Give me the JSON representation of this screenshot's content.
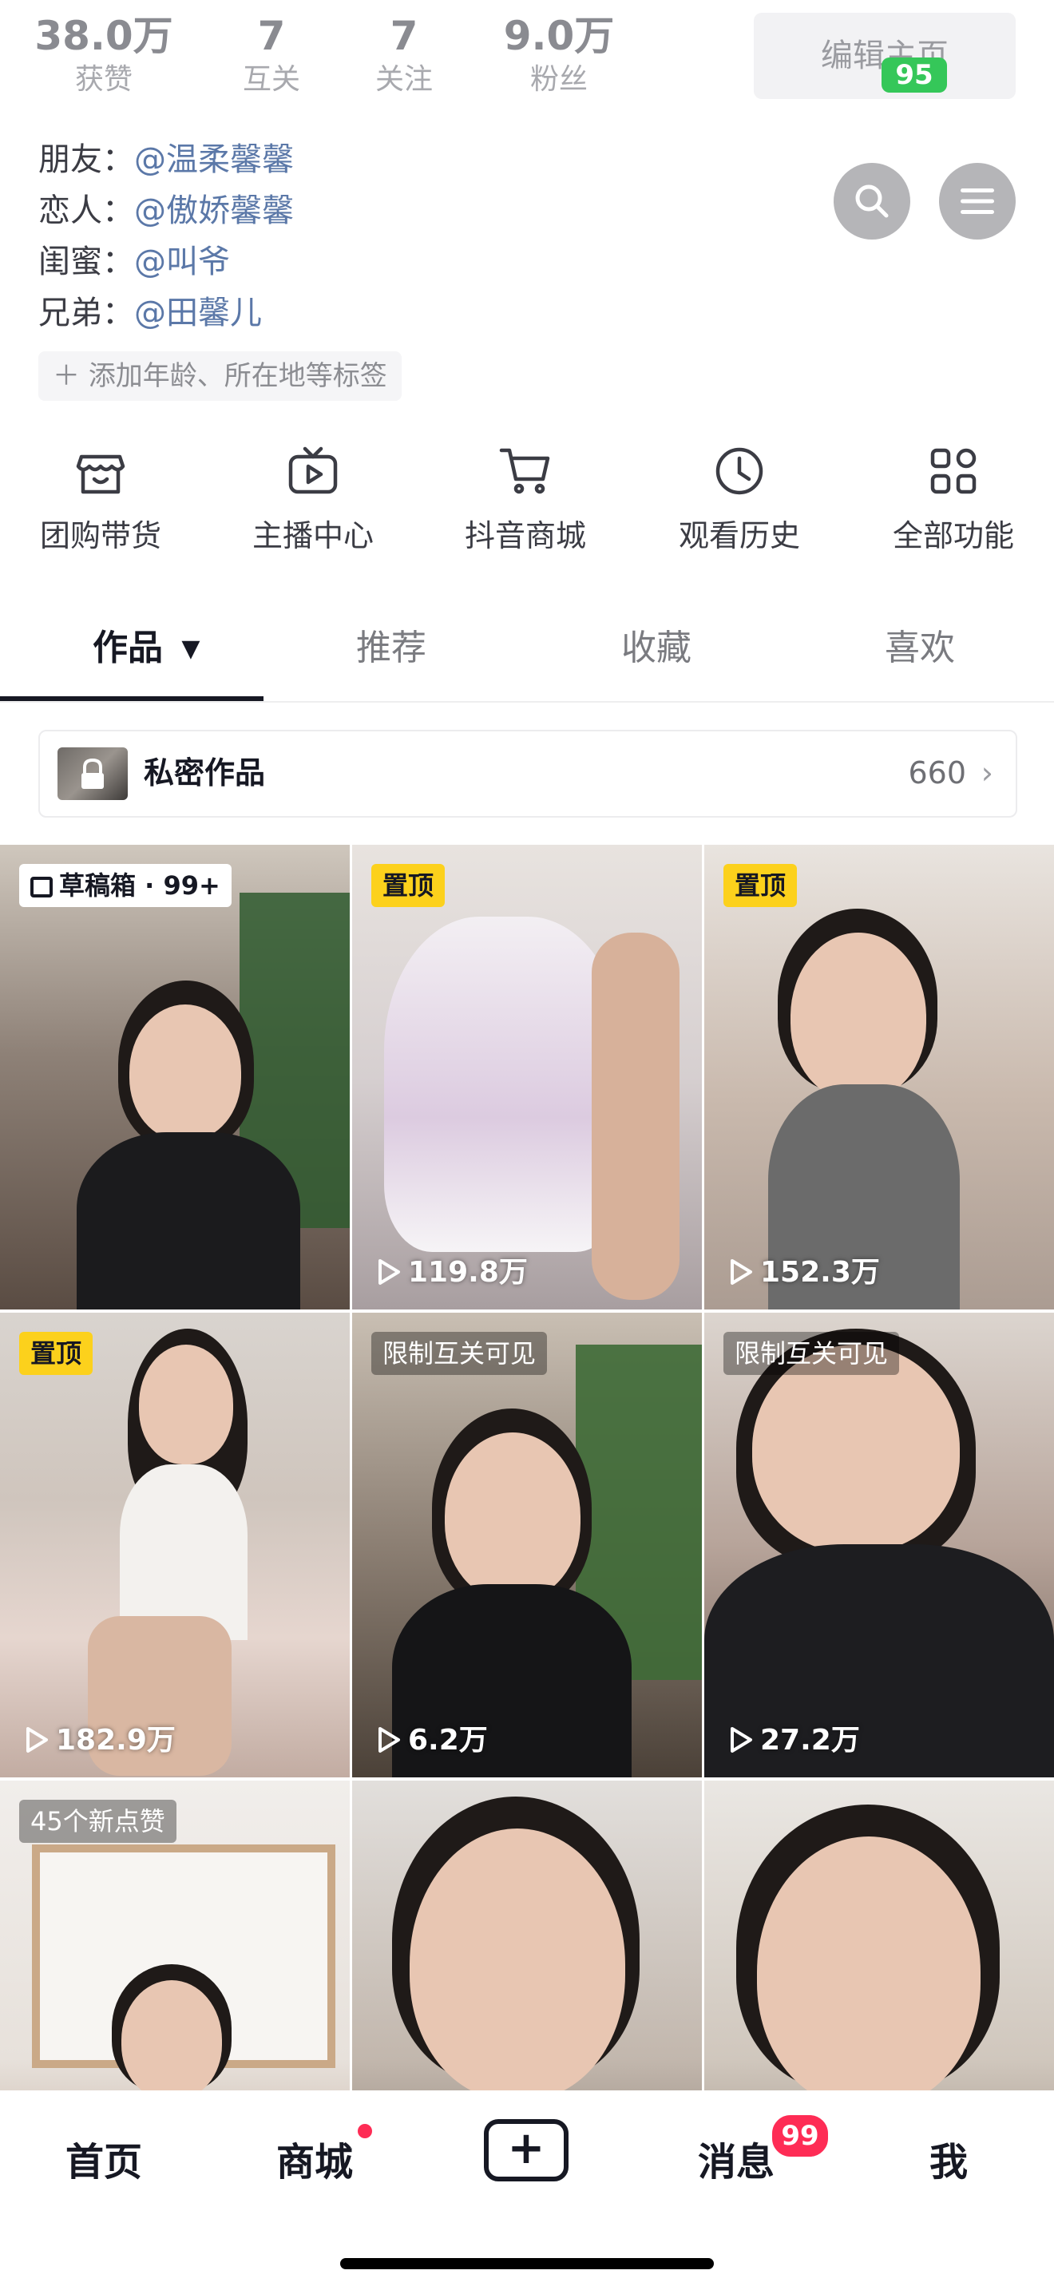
{
  "stats": [
    {
      "value": "38.0万",
      "label": "获赞"
    },
    {
      "value": "7",
      "label": "互关"
    },
    {
      "value": "7",
      "label": "关注"
    },
    {
      "value": "9.0万",
      "label": "粉丝"
    }
  ],
  "header": {
    "edit_label": "编辑主页",
    "battery": "95"
  },
  "relations": [
    {
      "role": "朋友：",
      "name": "@温柔馨馨"
    },
    {
      "role": "恋人：",
      "name": "@傲娇馨馨"
    },
    {
      "role": "闺蜜：",
      "name": "@叫爷"
    },
    {
      "role": "兄弟：",
      "name": "@田馨儿"
    }
  ],
  "add_tag_label": "添加年龄、所在地等标签",
  "functions": [
    {
      "label": "团购带货",
      "icon": "store-icon"
    },
    {
      "label": "主播中心",
      "icon": "tv-play-icon"
    },
    {
      "label": "抖音商城",
      "icon": "cart-icon"
    },
    {
      "label": "观看历史",
      "icon": "clock-icon"
    },
    {
      "label": "全部功能",
      "icon": "grid-icon"
    }
  ],
  "tabs": [
    "作品",
    "推荐",
    "收藏",
    "喜欢"
  ],
  "private_works": {
    "label": "私密作品",
    "count": "660"
  },
  "grid": [
    {
      "badge": "草稿箱 · 99+",
      "badge_type": "draft",
      "plays": ""
    },
    {
      "badge": "置顶",
      "badge_type": "yellow",
      "plays": "119.8万"
    },
    {
      "badge": "置顶",
      "badge_type": "yellow",
      "plays": "152.3万"
    },
    {
      "badge": "置顶",
      "badge_type": "yellow",
      "plays": "182.9万"
    },
    {
      "badge": "限制互关可见",
      "badge_type": "dark",
      "plays": "6.2万"
    },
    {
      "badge": "限制互关可见",
      "badge_type": "dark",
      "plays": "27.2万"
    },
    {
      "badge": "45个新点赞",
      "badge_type": "dark",
      "plays": ""
    },
    {
      "badge": "",
      "badge_type": "",
      "plays": ""
    },
    {
      "badge": "",
      "badge_type": "",
      "plays": ""
    }
  ],
  "nav": {
    "home": "首页",
    "mall": "商城",
    "plus": "+",
    "messages": "消息",
    "messages_badge": "99",
    "me": "我"
  },
  "colors": {
    "accent_red": "#fe2c55",
    "pin_yellow": "#fcd11c",
    "link_blue": "#5b78a8"
  }
}
